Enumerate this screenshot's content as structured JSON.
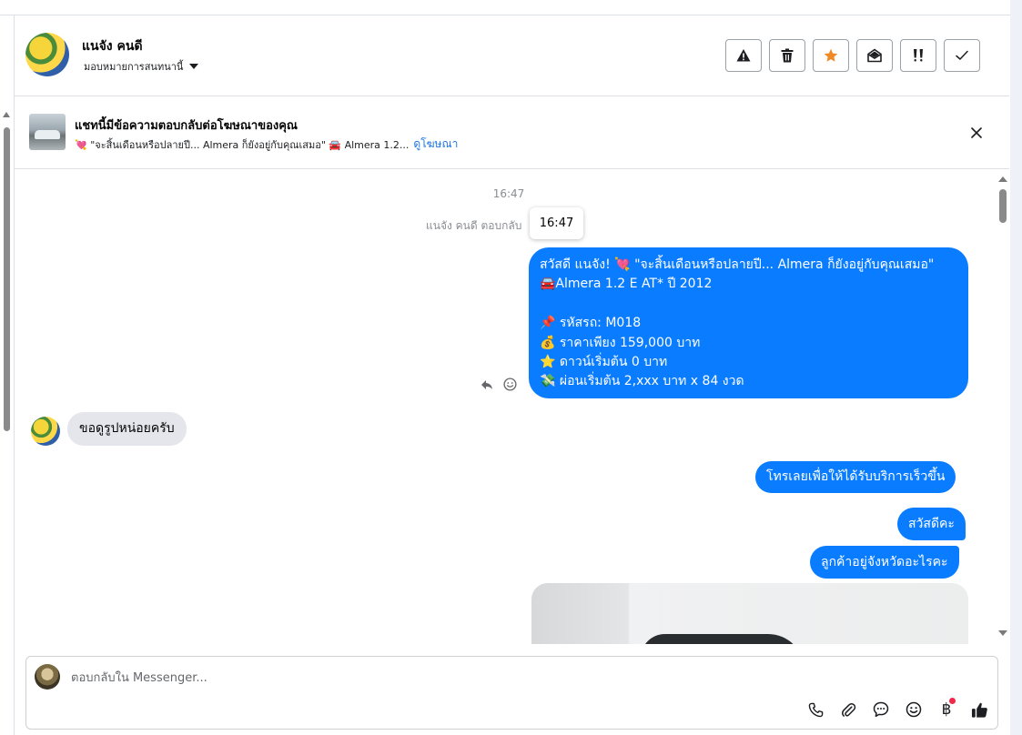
{
  "header": {
    "contact_name": "แนจัง คนดี",
    "assign_label": "มอบหมายการสนทนานี้",
    "actions": [
      {
        "icon": "warning-icon",
        "name": "spam-button"
      },
      {
        "icon": "trash-icon",
        "name": "delete-button"
      },
      {
        "icon": "star-icon",
        "name": "star-button",
        "color": "#f08a24"
      },
      {
        "icon": "envelope-open-icon",
        "name": "mark-unread-button"
      },
      {
        "icon": "follow-up-icon",
        "name": "follow-up-button"
      },
      {
        "icon": "check-icon",
        "name": "mark-done-button"
      }
    ]
  },
  "ad_banner": {
    "title": "แชทนี้มีข้อความตอบกลับต่อโฆษณาของคุณ",
    "snippet": "💘 \"จะสิ้นเดือนหรือปลายปี... Almera ก็ยังอยู่กับคุณเสมอ\" 🚘 Almera 1.2...",
    "link": "ดูโฆษณา"
  },
  "conversation": {
    "timestamp": "16:47",
    "reply_note": "แนจัง คนดี ตอบกลับ",
    "tooltip_time": "16:47",
    "ad_message_lines": [
      "สวัสดี แนจัง! 💘 \"จะสิ้นเดือนหรือปลายปี... Almera ก็ยังอยู่กับคุณเสมอ\"",
      "🚘Almera 1.2 E AT* ปี 2012",
      "",
      "📌 รหัสรถ: M018",
      "💰 ราคาเพียง 159,000 บาท",
      "⭐ ดาวน์เริ่มต้น 0 บาท",
      "💸 ผ่อนเริ่มต้น 2,xxx บาท x 84 งวด"
    ],
    "incoming_message": "ขอดูรูปหน่อยครับ",
    "outgoing_messages": [
      "โทรเลยเพื่อให้ได้รับบริการเร็วขึ้น",
      "สวัสดีคะ",
      "ลูกค้าอยู่จังหวัดอะไรคะ"
    ]
  },
  "composer": {
    "placeholder": "ตอบกลับใน Messenger...",
    "tools": [
      "phone-icon",
      "paperclip-icon",
      "speech-bubble-icon",
      "emoji-icon",
      "baht-icon",
      "thumbs-up-icon"
    ],
    "baht_symbol": "฿"
  },
  "colors": {
    "accent": "#0a7cff",
    "link": "#1b74e4",
    "incoming_bubble": "#e4e6eb",
    "notification_dot": "#f02849"
  }
}
